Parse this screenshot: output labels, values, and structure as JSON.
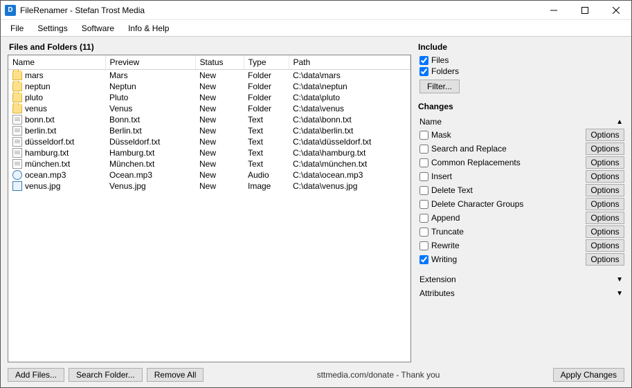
{
  "window": {
    "title": "FileRenamer - Stefan Trost Media"
  },
  "menu": {
    "items": [
      "File",
      "Settings",
      "Software",
      "Info & Help"
    ]
  },
  "list": {
    "heading": "Files and Folders (11)",
    "columns": [
      "Name",
      "Preview",
      "Status",
      "Type",
      "Path"
    ],
    "rows": [
      {
        "icon": "folder",
        "name": "mars",
        "preview": "Mars",
        "status": "New",
        "type": "Folder",
        "path": "C:\\data\\mars"
      },
      {
        "icon": "folder",
        "name": "neptun",
        "preview": "Neptun",
        "status": "New",
        "type": "Folder",
        "path": "C:\\data\\neptun"
      },
      {
        "icon": "folder",
        "name": "pluto",
        "preview": "Pluto",
        "status": "New",
        "type": "Folder",
        "path": "C:\\data\\pluto"
      },
      {
        "icon": "folder",
        "name": "venus",
        "preview": "Venus",
        "status": "New",
        "type": "Folder",
        "path": "C:\\data\\venus"
      },
      {
        "icon": "text",
        "name": "bonn.txt",
        "preview": "Bonn.txt",
        "status": "New",
        "type": "Text",
        "path": "C:\\data\\bonn.txt"
      },
      {
        "icon": "text",
        "name": "berlin.txt",
        "preview": "Berlin.txt",
        "status": "New",
        "type": "Text",
        "path": "C:\\data\\berlin.txt"
      },
      {
        "icon": "text",
        "name": "düsseldorf.txt",
        "preview": "Düsseldorf.txt",
        "status": "New",
        "type": "Text",
        "path": "C:\\data\\düsseldorf.txt"
      },
      {
        "icon": "text",
        "name": "hamburg.txt",
        "preview": "Hamburg.txt",
        "status": "New",
        "type": "Text",
        "path": "C:\\data\\hamburg.txt"
      },
      {
        "icon": "text",
        "name": "münchen.txt",
        "preview": "München.txt",
        "status": "New",
        "type": "Text",
        "path": "C:\\data\\münchen.txt"
      },
      {
        "icon": "audio",
        "name": "ocean.mp3",
        "preview": "Ocean.mp3",
        "status": "New",
        "type": "Audio",
        "path": "C:\\data\\ocean.mp3"
      },
      {
        "icon": "image",
        "name": "venus.jpg",
        "preview": "Venus.jpg",
        "status": "New",
        "type": "Image",
        "path": "C:\\data\\venus.jpg"
      }
    ]
  },
  "include": {
    "heading": "Include",
    "files_label": "Files",
    "files_checked": true,
    "folders_label": "Folders",
    "folders_checked": true,
    "filter_button": "Filter..."
  },
  "changes": {
    "heading": "Changes",
    "group_name": "Name",
    "options_label": "Options",
    "items": [
      {
        "label": "Mask",
        "checked": false
      },
      {
        "label": "Search and Replace",
        "checked": false
      },
      {
        "label": "Common Replacements",
        "checked": false
      },
      {
        "label": "Insert",
        "checked": false
      },
      {
        "label": "Delete Text",
        "checked": false
      },
      {
        "label": "Delete Character Groups",
        "checked": false
      },
      {
        "label": "Append",
        "checked": false
      },
      {
        "label": "Truncate",
        "checked": false
      },
      {
        "label": "Rewrite",
        "checked": false
      },
      {
        "label": "Writing",
        "checked": true
      }
    ],
    "group_extension": "Extension",
    "group_attributes": "Attributes"
  },
  "footer": {
    "add_files": "Add Files...",
    "search_folder": "Search Folder...",
    "remove_all": "Remove All",
    "donate": "sttmedia.com/donate - Thank you",
    "apply": "Apply Changes"
  }
}
